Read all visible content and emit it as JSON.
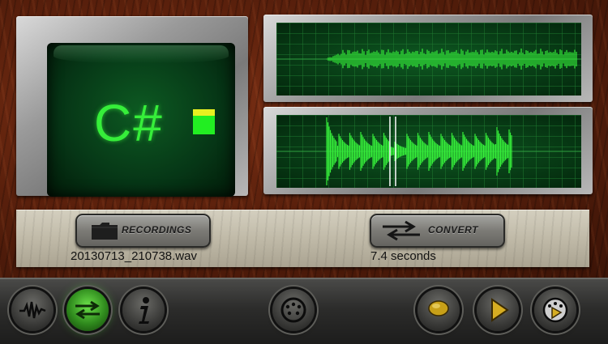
{
  "display": {
    "note": "C#"
  },
  "panel": {
    "recordings_label": "RECORDINGS",
    "convert_label": "CONVERT",
    "filename": "20130713_210738.wav",
    "duration": "7.4 seconds"
  },
  "colors": {
    "phosphor": "#36ee3a",
    "grid": "#1f7a30",
    "level": "#22ee22",
    "level_peak": "#e8f020"
  },
  "icons": {
    "toolbar": [
      "waveform-icon",
      "convert-arrows-icon",
      "info-icon",
      "midi-icon",
      "record-icon",
      "play-icon",
      "play-midi-icon"
    ]
  }
}
